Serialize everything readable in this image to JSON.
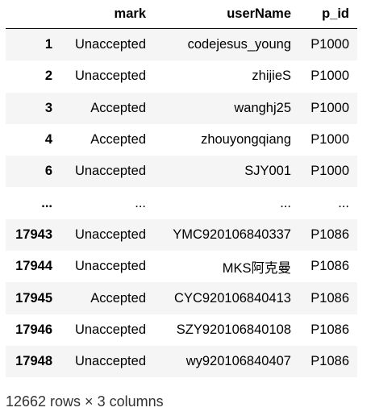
{
  "table": {
    "columns": [
      "",
      "mark",
      "userName",
      "p_id"
    ],
    "rows": [
      {
        "index": "1",
        "mark": "Unaccepted",
        "userName": "codejesus_young",
        "p_id": "P1000"
      },
      {
        "index": "2",
        "mark": "Unaccepted",
        "userName": "zhijieS",
        "p_id": "P1000"
      },
      {
        "index": "3",
        "mark": "Accepted",
        "userName": "wanghj25",
        "p_id": "P1000"
      },
      {
        "index": "4",
        "mark": "Accepted",
        "userName": "zhouyongqiang",
        "p_id": "P1000"
      },
      {
        "index": "6",
        "mark": "Unaccepted",
        "userName": "SJY001",
        "p_id": "P1000"
      },
      {
        "index": "...",
        "mark": "...",
        "userName": "...",
        "p_id": "..."
      },
      {
        "index": "17943",
        "mark": "Unaccepted",
        "userName": "YMC920106840337",
        "p_id": "P1086"
      },
      {
        "index": "17944",
        "mark": "Unaccepted",
        "userName": "MKS阿克曼",
        "p_id": "P1086"
      },
      {
        "index": "17945",
        "mark": "Accepted",
        "userName": "CYC920106840413",
        "p_id": "P1086"
      },
      {
        "index": "17946",
        "mark": "Unaccepted",
        "userName": "SZY920106840108",
        "p_id": "P1086"
      },
      {
        "index": "17948",
        "mark": "Unaccepted",
        "userName": "wy920106840407",
        "p_id": "P1086"
      }
    ]
  },
  "shape_text": "12662 rows × 3 columns"
}
